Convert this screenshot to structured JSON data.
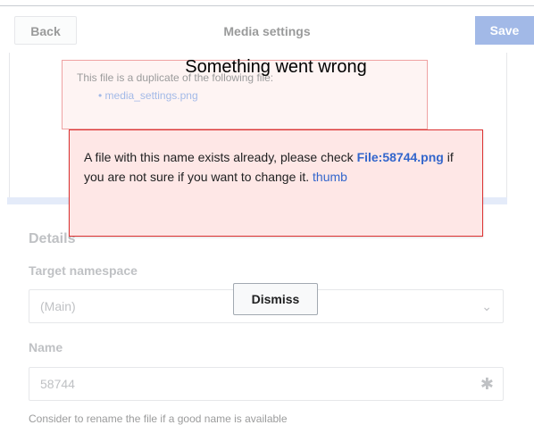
{
  "dialog": {
    "title": "Media settings",
    "back_label": "Back",
    "save_label": "Save"
  },
  "background_warning": {
    "message": "This file is a duplicate of the following file:",
    "items": [
      "media_settings.png"
    ]
  },
  "details": {
    "section_title": "Details",
    "namespace_label": "Target namespace",
    "namespace_value": "(Main)",
    "name_label": "Name",
    "name_value": "58744",
    "bottom_text": "Consider to rename the file if a good name is available"
  },
  "error": {
    "title": "Something went wrong",
    "message_before": "A file with this name exists already, please check",
    "file_link": "File:58744.png",
    "message_after": "if you are not sure if you want to change it.",
    "thumb_link": "thumb",
    "dismiss_label": "Dismiss"
  },
  "colors": {
    "link": "#3366cc",
    "error_border": "#dd3333",
    "error_bg": "#fee7e6"
  },
  "icons": {
    "namespace_dropdown": "chevron-down-icon",
    "name_required": "required-asterisk-icon"
  }
}
